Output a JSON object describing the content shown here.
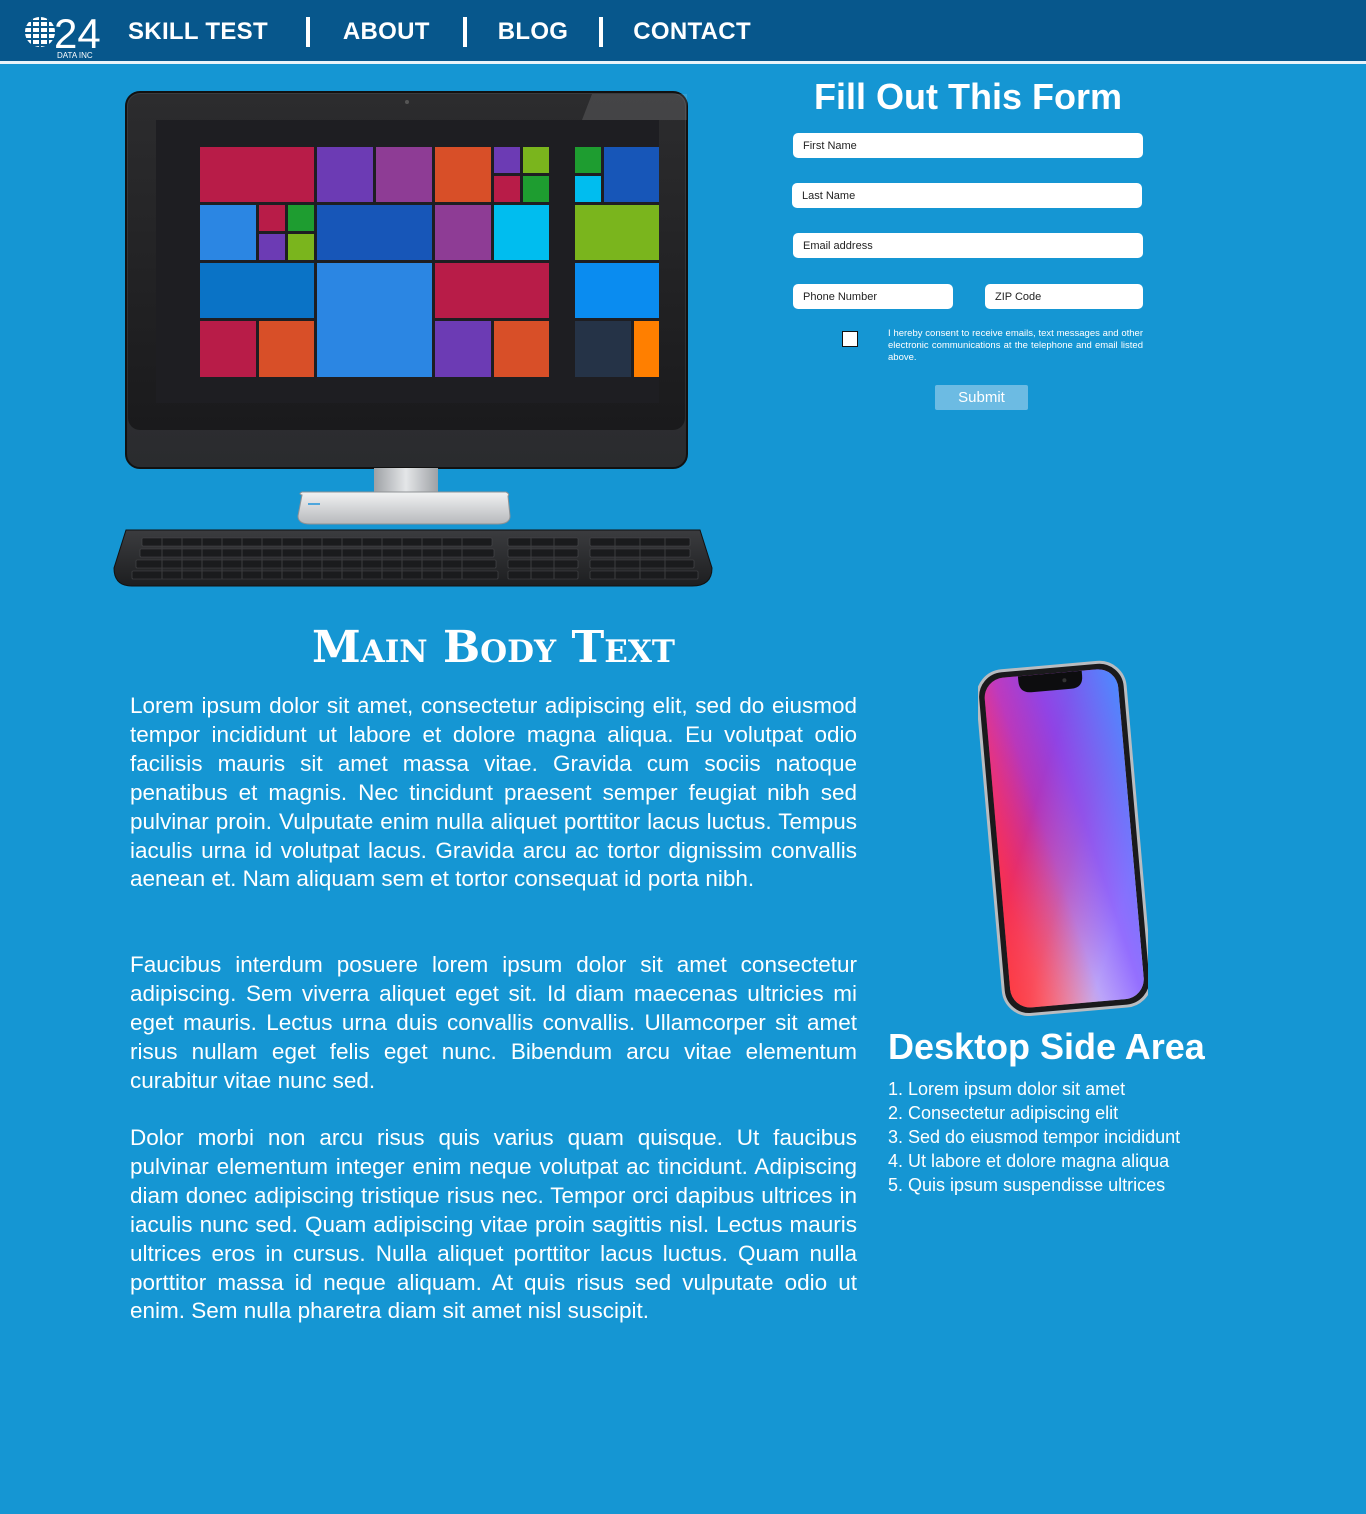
{
  "brand": {
    "logo_number": "24",
    "logo_subtext": "DATA INC"
  },
  "nav": {
    "items": [
      {
        "label": "SKILL TEST"
      },
      {
        "label": "ABOUT"
      },
      {
        "label": "BLOG"
      },
      {
        "label": "CONTACT"
      }
    ]
  },
  "form": {
    "title": "Fill Out This Form",
    "first_name_placeholder": "First Name",
    "last_name_placeholder": "Last Name",
    "email_placeholder": "Email address",
    "phone_placeholder": "Phone Number",
    "zip_placeholder": "ZIP Code",
    "consent_checked": false,
    "consent_text": "I hereby consent to receive emails, text messages and other electronic communications at the telephone and email listed above.",
    "submit_label": "Submit"
  },
  "main": {
    "title": "Main Body Text",
    "paragraphs": [
      "Lorem ipsum dolor sit amet, consectetur adipiscing elit, sed do eiusmod tempor incididunt ut labore et dolore magna aliqua. Eu volutpat odio facilisis mauris sit amet massa vitae. Gravida cum sociis natoque penatibus et magnis. Nec tincidunt praesent semper feugiat nibh sed pulvinar proin. Vulputate enim nulla aliquet porttitor lacus luctus. Tempus iaculis urna id volutpat lacus. Gravida arcu ac tortor dignissim convallis aenean et. Nam aliquam sem et tortor consequat id porta nibh.",
      "Faucibus interdum posuere lorem ipsum dolor sit amet consectetur adipiscing. Sem viverra aliquet eget sit. Id diam maecenas ultricies mi eget mauris. Lectus urna duis convallis convallis. Ullamcorper sit amet risus nullam eget felis eget nunc. Bibendum arcu vitae elementum curabitur vitae nunc sed.",
      "Dolor morbi non arcu risus quis varius quam quisque. Ut faucibus pulvinar elementum integer enim neque volutpat ac tincidunt. Adipiscing diam donec adipiscing tristique risus nec. Tempor orci dapibus ultrices in iaculis nunc sed. Quam adipiscing vitae proin sagittis nisl. Lectus mauris ultrices eros in cursus. Nulla aliquet porttitor lacus luctus. Quam nulla porttitor massa id neque aliquam. At quis risus sed vulputate odio ut enim. Sem nulla pharetra diam sit amet nisl suscipit."
    ]
  },
  "side": {
    "title": "Desktop Side Area",
    "items": [
      "1. Lorem ipsum dolor sit amet",
      "2. Consectetur adipiscing elit",
      "3. Sed do eiusmod tempor incididunt",
      "4. Ut labore et dolore magna aliqua",
      "5. Quis ipsum suspendisse ultrices"
    ]
  },
  "images": {
    "computer_icon": "desktop-computer-icon",
    "phone_icon": "smartphone-icon"
  },
  "colors": {
    "page_background": "#1596d3",
    "header_background": "#07578c",
    "submit_button": "#6cbbe3"
  }
}
